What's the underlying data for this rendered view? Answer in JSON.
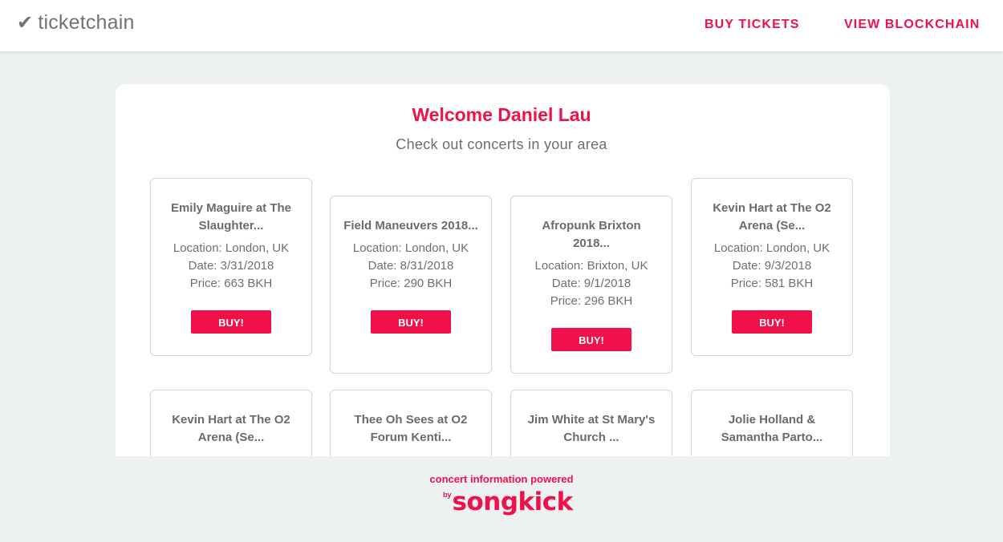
{
  "header": {
    "brand_icon": "✔",
    "brand": "ticketchain",
    "nav": [
      {
        "label": "BUY TICKETS"
      },
      {
        "label": "VIEW BLOCKCHAIN"
      }
    ]
  },
  "main": {
    "welcome": "Welcome Daniel Lau",
    "subtitle": "Check out concerts in your area",
    "concerts": [
      {
        "title": "Emily Maguire at The Slaughter...",
        "location": "Location: London, UK",
        "date": "Date: 3/31/2018",
        "price": "Price: 663 BKH",
        "buy_label": "BUY!"
      },
      {
        "title": "Field Maneuvers 2018...",
        "location": "Location: London, UK",
        "date": "Date: 8/31/2018",
        "price": "Price: 290 BKH",
        "buy_label": "BUY!"
      },
      {
        "title": "Afropunk Brixton 2018...",
        "location": "Location: Brixton, UK",
        "date": "Date: 9/1/2018",
        "price": "Price: 296 BKH",
        "buy_label": "BUY!"
      },
      {
        "title": "Kevin Hart at The O2 Arena (Se...",
        "location": "Location: London, UK",
        "date": "Date: 9/3/2018",
        "price": "Price: 581 BKH",
        "buy_label": "BUY!"
      },
      {
        "title": "Kevin Hart at The O2 Arena (Se..."
      },
      {
        "title": "Thee Oh Sees at O2 Forum Kenti..."
      },
      {
        "title": "Jim White at St Mary's Church ..."
      },
      {
        "title": "Jolie Holland & Samantha Parto..."
      }
    ]
  },
  "footer": {
    "text": "concert information powered",
    "by": "by",
    "logo": "songkick"
  },
  "colors": {
    "accent": "#f0104a",
    "background": "#eef1f2",
    "text_gray": "#707070"
  },
  "icons": {
    "brand_icon": "check-icon"
  }
}
